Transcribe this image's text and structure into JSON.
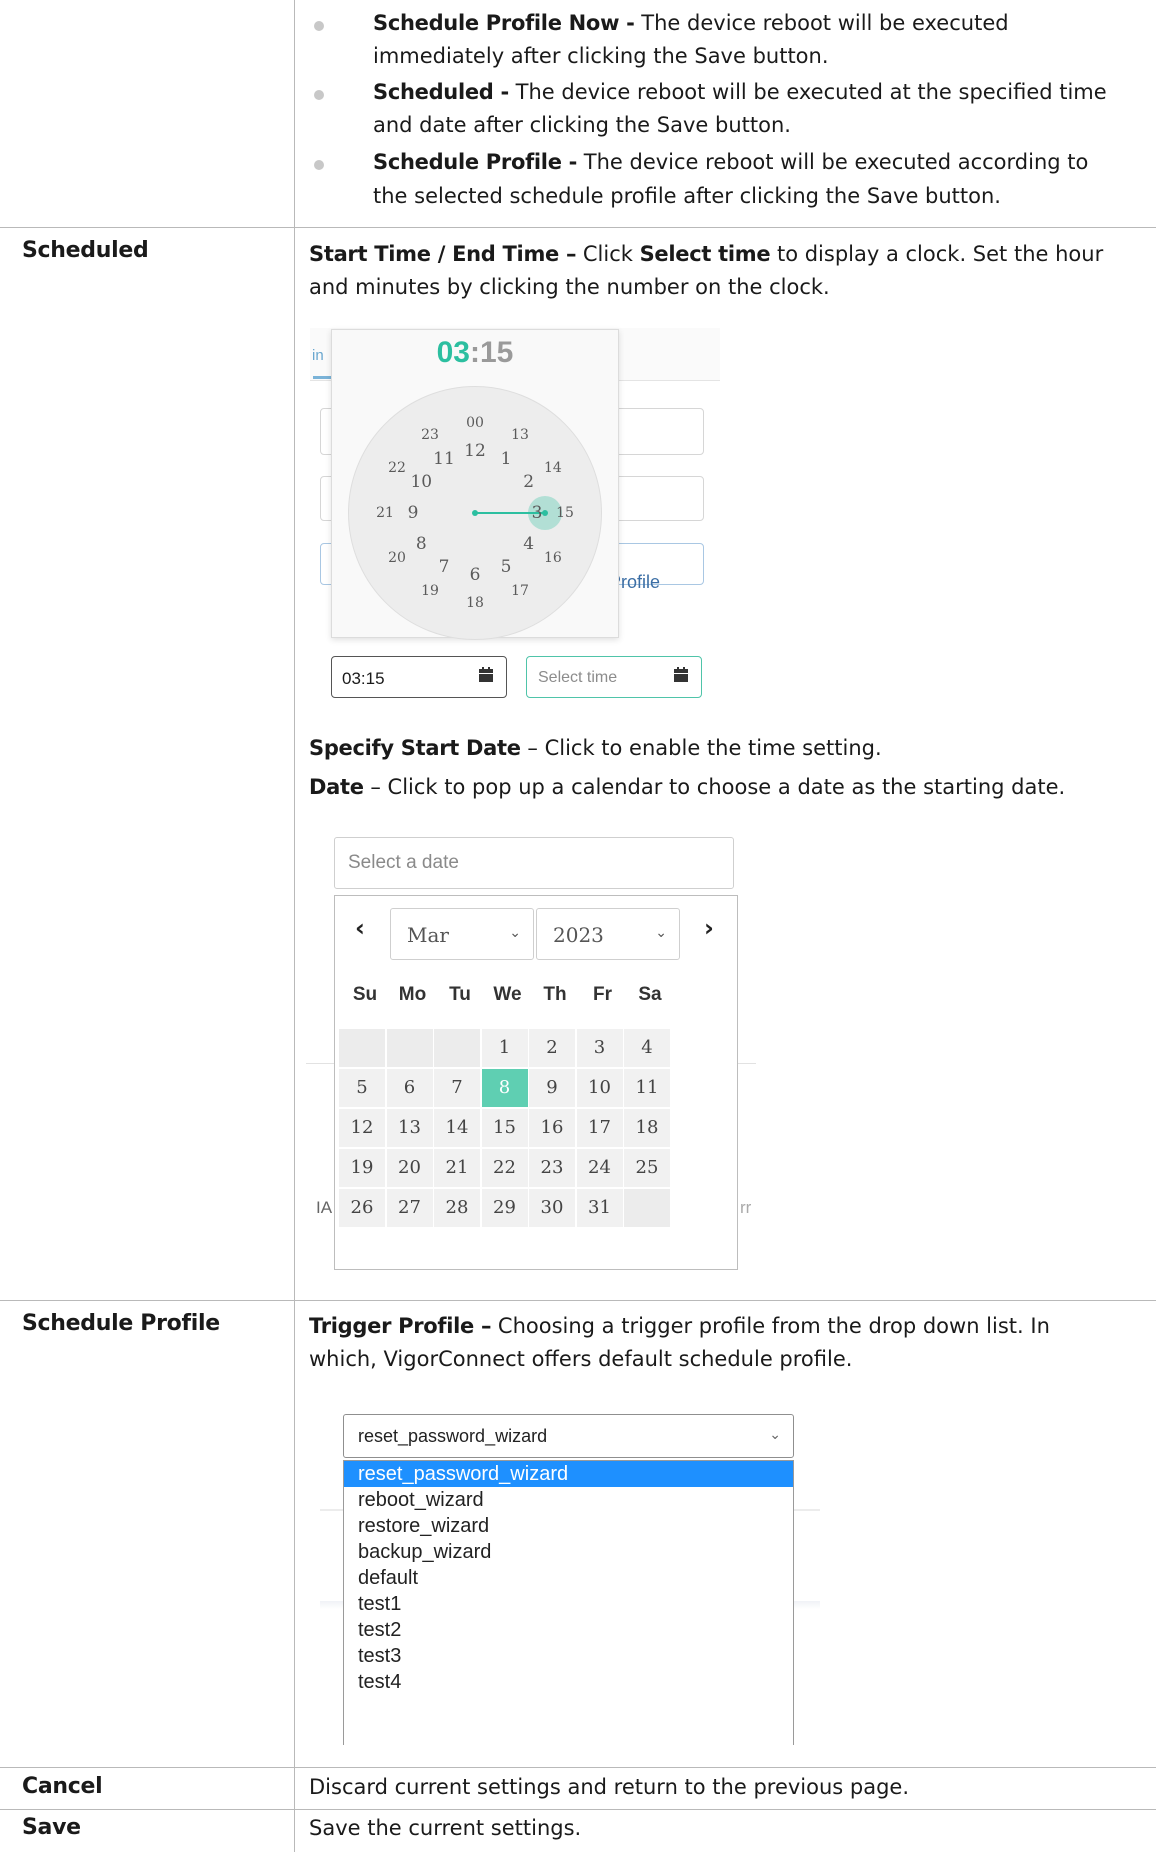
{
  "intro_bullets": [
    {
      "term": "Schedule Profile Now -",
      "line1": "The device reboot will be executed",
      "line2": "immediately after clicking the Save button."
    },
    {
      "term": "Scheduled -",
      "line1": "The device reboot will be executed at the specified time",
      "line2": "and date after clicking the Save button."
    },
    {
      "term": "Schedule Profile -",
      "line1": "The device reboot will be executed according to",
      "line2": "the selected schedule profile after clicking the Save button."
    }
  ],
  "rows": {
    "scheduled": {
      "label": "Scheduled",
      "start_end": {
        "term": "Start Time / End Time –",
        "pre": "Click",
        "strong": "Select time",
        "post": "to display a clock. Set the hour",
        "line2": "and minutes by clicking the number on the clock."
      },
      "specify_start": {
        "term": "Specify Start Date",
        "text": "– Click to enable the time setting."
      },
      "date": {
        "term": "Date",
        "text": "– Click to pop up a calendar to choose a date as the starting date."
      }
    },
    "schedule_profile": {
      "label": "Schedule Profile",
      "term": "Trigger Profile –",
      "line1": "Choosing a trigger profile from the drop down list. In",
      "line2": "which, VigorConnect offers default schedule profile."
    },
    "cancel": {
      "label": "Cancel",
      "text": "Discard current settings and return to the previous page."
    },
    "save": {
      "label": "Save",
      "text": "Save the current settings."
    }
  },
  "time_picker": {
    "hour": "03",
    "separator": ":",
    "minute": "15",
    "outer_numbers": [
      "00",
      "13",
      "14",
      "15",
      "16",
      "17",
      "18",
      "19",
      "20",
      "21",
      "22",
      "23"
    ],
    "inner_numbers": [
      "12",
      "1",
      "2",
      "3",
      "4",
      "5",
      "6",
      "7",
      "8",
      "9",
      "10",
      "11"
    ],
    "start_value": "03:15",
    "end_placeholder": "Select time",
    "background_snippets": {
      "tab": "in",
      "profile_button": "e Profile"
    },
    "accent_color": "#2cbfa0"
  },
  "date_picker": {
    "placeholder": "Select a date",
    "prev_arrow": "‹",
    "next_arrow": "›",
    "month": "Mar",
    "year": "2023",
    "weekdays": [
      "Su",
      "Mo",
      "Tu",
      "We",
      "Th",
      "Fr",
      "Sa"
    ],
    "first_weekday_index": 3,
    "days": [
      "1",
      "2",
      "3",
      "4",
      "5",
      "6",
      "7",
      "8",
      "9",
      "10",
      "11",
      "12",
      "13",
      "14",
      "15",
      "16",
      "17",
      "18",
      "19",
      "20",
      "21",
      "22",
      "23",
      "24",
      "25",
      "26",
      "27",
      "28",
      "29",
      "30",
      "31"
    ],
    "selected_day": "8",
    "background_snippets": {
      "left": "IA",
      "right": "rr"
    },
    "selected_color": "#5fcfb2"
  },
  "trigger_dropdown": {
    "selected": "reset_password_wizard",
    "options": [
      "reset_password_wizard",
      "reboot_wizard",
      "restore_wizard",
      "backup_wizard",
      "default",
      "test1",
      "test2",
      "test3",
      "test4"
    ],
    "highlight_color": "#1e90ff"
  }
}
